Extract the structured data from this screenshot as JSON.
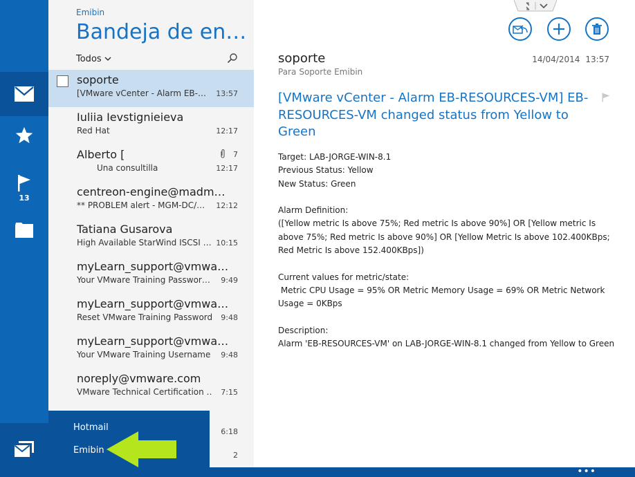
{
  "rail": {
    "mail_icon": "mail-icon",
    "favorites_icon": "star-icon",
    "flagged_icon": "flag-icon",
    "flagged_count": "13",
    "folders_icon": "folder-icon",
    "accounts_icon": "accounts-mail-icon"
  },
  "list": {
    "account": "Emibin",
    "folder_title": "Bandeja de en…",
    "filter_label": "Todos",
    "search_icon": "search-icon",
    "messages": [
      {
        "from": "soporte",
        "subject": "[VMware vCenter - Alarm EB-…",
        "time": "13:57",
        "selected": true
      },
      {
        "from": "Iuliia Ievstignieieva",
        "subject": "Red Hat",
        "time": "12:17"
      },
      {
        "from": "Alberto [",
        "subject": "Una consultilla",
        "time": "12:17",
        "count": "7",
        "attachment": true
      },
      {
        "from": "centreon-engine@madm…",
        "subject": "** PROBLEM alert - MGM-DC/…",
        "time": "12:12"
      },
      {
        "from": "Tatiana Gusarova",
        "subject": "High Available StarWind ISCSI …",
        "time": "10:15"
      },
      {
        "from": "myLearn_support@vmwa…",
        "subject": "Your VMware Training Passwor…",
        "time": "9:49"
      },
      {
        "from": "myLearn_support@vmwa…",
        "subject": "Reset VMware Training Password",
        "time": "9:48"
      },
      {
        "from": "myLearn_support@vmwa…",
        "subject": "Your VMware Training Username",
        "time": "9:48"
      },
      {
        "from": "noreply@vmware.com",
        "subject": "VMware Technical Certification …",
        "time": "7:15"
      }
    ],
    "partial_time_1": "6:18",
    "partial_count_2": "2"
  },
  "accounts": {
    "hotmail": "Hotmail",
    "emibin": "Emibin"
  },
  "reader": {
    "sender": "soporte",
    "to_label": "Para",
    "to_name": "Soporte Emibin",
    "date": "14/04/2014",
    "time": "13:57",
    "subject": "[VMware vCenter - Alarm EB-RESOURCES-VM] EB-RESOURCES-VM changed status from Yellow to Green",
    "body": {
      "target": "Target: LAB-JORGE-WIN-8.1",
      "previous_status": "Previous Status: Yellow",
      "new_status": "New Status: Green",
      "alarm_definition_label": "Alarm Definition:",
      "alarm_definition": "([Yellow metric Is above 75%; Red metric Is above 90%] OR [Yellow metric Is above 75%; Red metric Is above 90%] OR [Yellow Metric Is above 102.400KBps; Red Metric Is above 152.400KBps])",
      "current_values_label": "Current values for metric/state:",
      "current_values": " Metric CPU Usage = 95% OR Metric Memory Usage = 69% OR Metric Network Usage = 0KBps",
      "description_label": "Description:",
      "description": "Alarm 'EB-RESOURCES-VM' on LAB-JORGE-WIN-8.1 changed from Yellow to Green"
    },
    "actions": [
      "reply-icon",
      "plus-icon",
      "trash-icon"
    ]
  },
  "bottom_bar": {
    "more": "•••"
  },
  "colors": {
    "accent": "#1574c6",
    "rail": "#0e66b6",
    "rail_dark": "#0a539b",
    "selected_row": "#c9ddf0",
    "arrow": "#b5e61d"
  }
}
